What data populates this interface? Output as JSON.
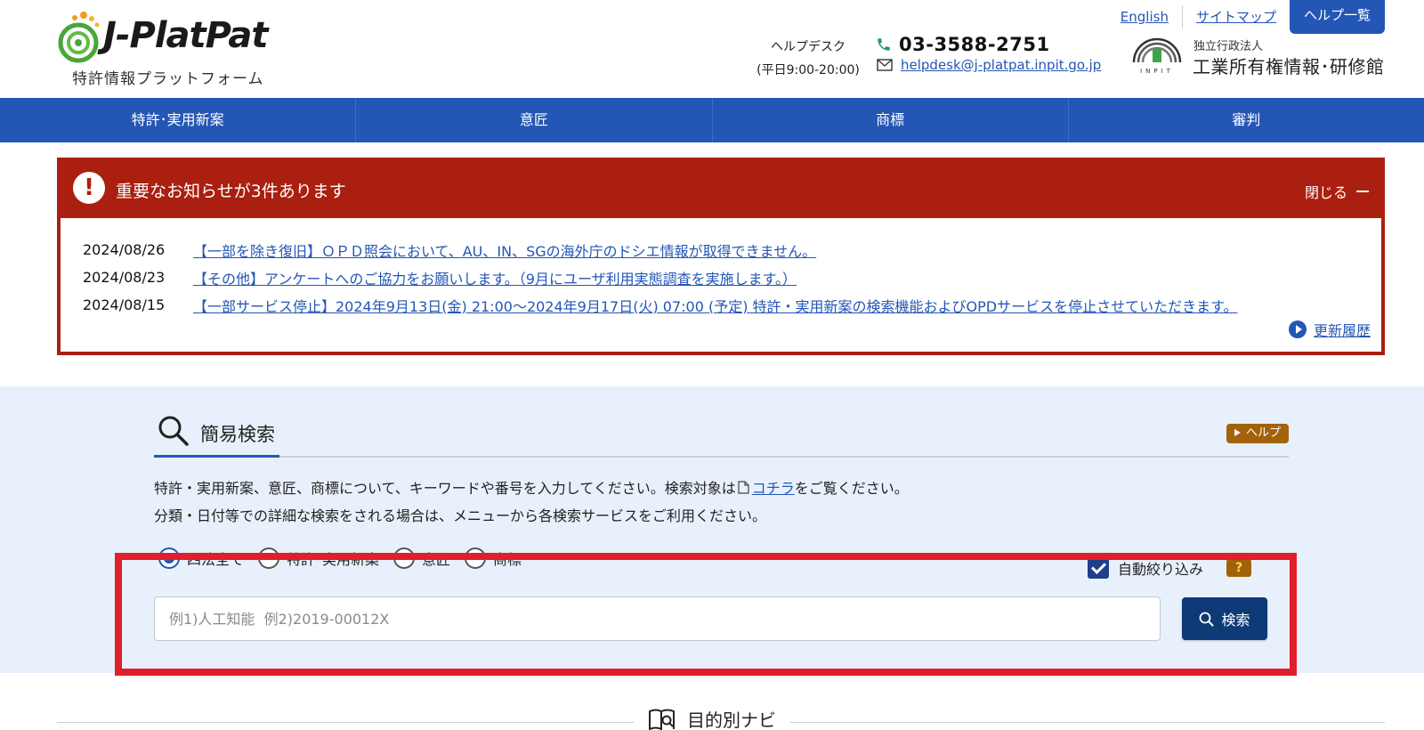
{
  "header": {
    "logo_wordmark": "J-PlatPat",
    "logo_subtitle": "特許情報プラットフォーム",
    "top_links": [
      {
        "label": "English"
      },
      {
        "label": "サイトマップ"
      }
    ],
    "help_list_label": "ヘルプ一覧",
    "helpdesk_label": "ヘルプデスク",
    "helpdesk_hours": "(平日9:00-20:00)",
    "phone": "03-3588-2751",
    "email": "helpdesk@j-platpat.inpit.go.jp",
    "inpit_org_type": "独立行政法人",
    "inpit_org_name": "工業所有権情報･研修館",
    "inpit_mark_text": "INPIT"
  },
  "nav": {
    "items": [
      {
        "label": "特許･実用新案"
      },
      {
        "label": "意匠"
      },
      {
        "label": "商標"
      },
      {
        "label": "審判"
      }
    ]
  },
  "notice": {
    "title": "重要なお知らせが3件あります",
    "close_label": "閉じる",
    "items": [
      {
        "date": "2024/08/26",
        "text": "【一部を除き復旧】ＯＰＤ照会において、AU、IN、SGの海外庁のドシエ情報が取得できません。"
      },
      {
        "date": "2024/08/23",
        "text": "【その他】アンケートへのご協力をお願いします。（9月にユーザ利用実態調査を実施します。）"
      },
      {
        "date": "2024/08/15",
        "text": "【一部サービス停止】2024年9月13日(金) 21:00～2024年9月17日(火) 07:00 (予定) 特許・実用新案の検索機能およびOPDサービスを停止させていただきます。"
      }
    ],
    "history_label": "更新履歴"
  },
  "search": {
    "title": "簡易検索",
    "help_label": "ヘルプ",
    "desc_line1_pre": "特許・実用新案、意匠、商標について、キーワードや番号を入力してください。検索対象は",
    "desc_line1_link": "コチラ",
    "desc_line1_post": "をご覧ください。",
    "desc_line2": "分類・日付等での詳細な検索をされる場合は、メニューから各検索サービスをご利用ください。",
    "radios": [
      {
        "label": "四法全て",
        "checked": true
      },
      {
        "label": "特許･実用新案",
        "checked": false
      },
      {
        "label": "意匠",
        "checked": false
      },
      {
        "label": "商標",
        "checked": false
      }
    ],
    "auto_narrow_label": "自動絞り込み",
    "question_badge": "?",
    "input_value": "",
    "input_placeholder": "例1)人工知能  例2)2019-00012X",
    "button_label": "検索"
  },
  "navi": {
    "title": "目的別ナビ"
  },
  "colors": {
    "brand_blue": "#2456b5",
    "notice_red": "#aa1f0f",
    "search_bg": "#e8f1fb",
    "search_button": "#0f3a78",
    "help_badge": "#a3620a",
    "highlight": "#e01e2c"
  }
}
